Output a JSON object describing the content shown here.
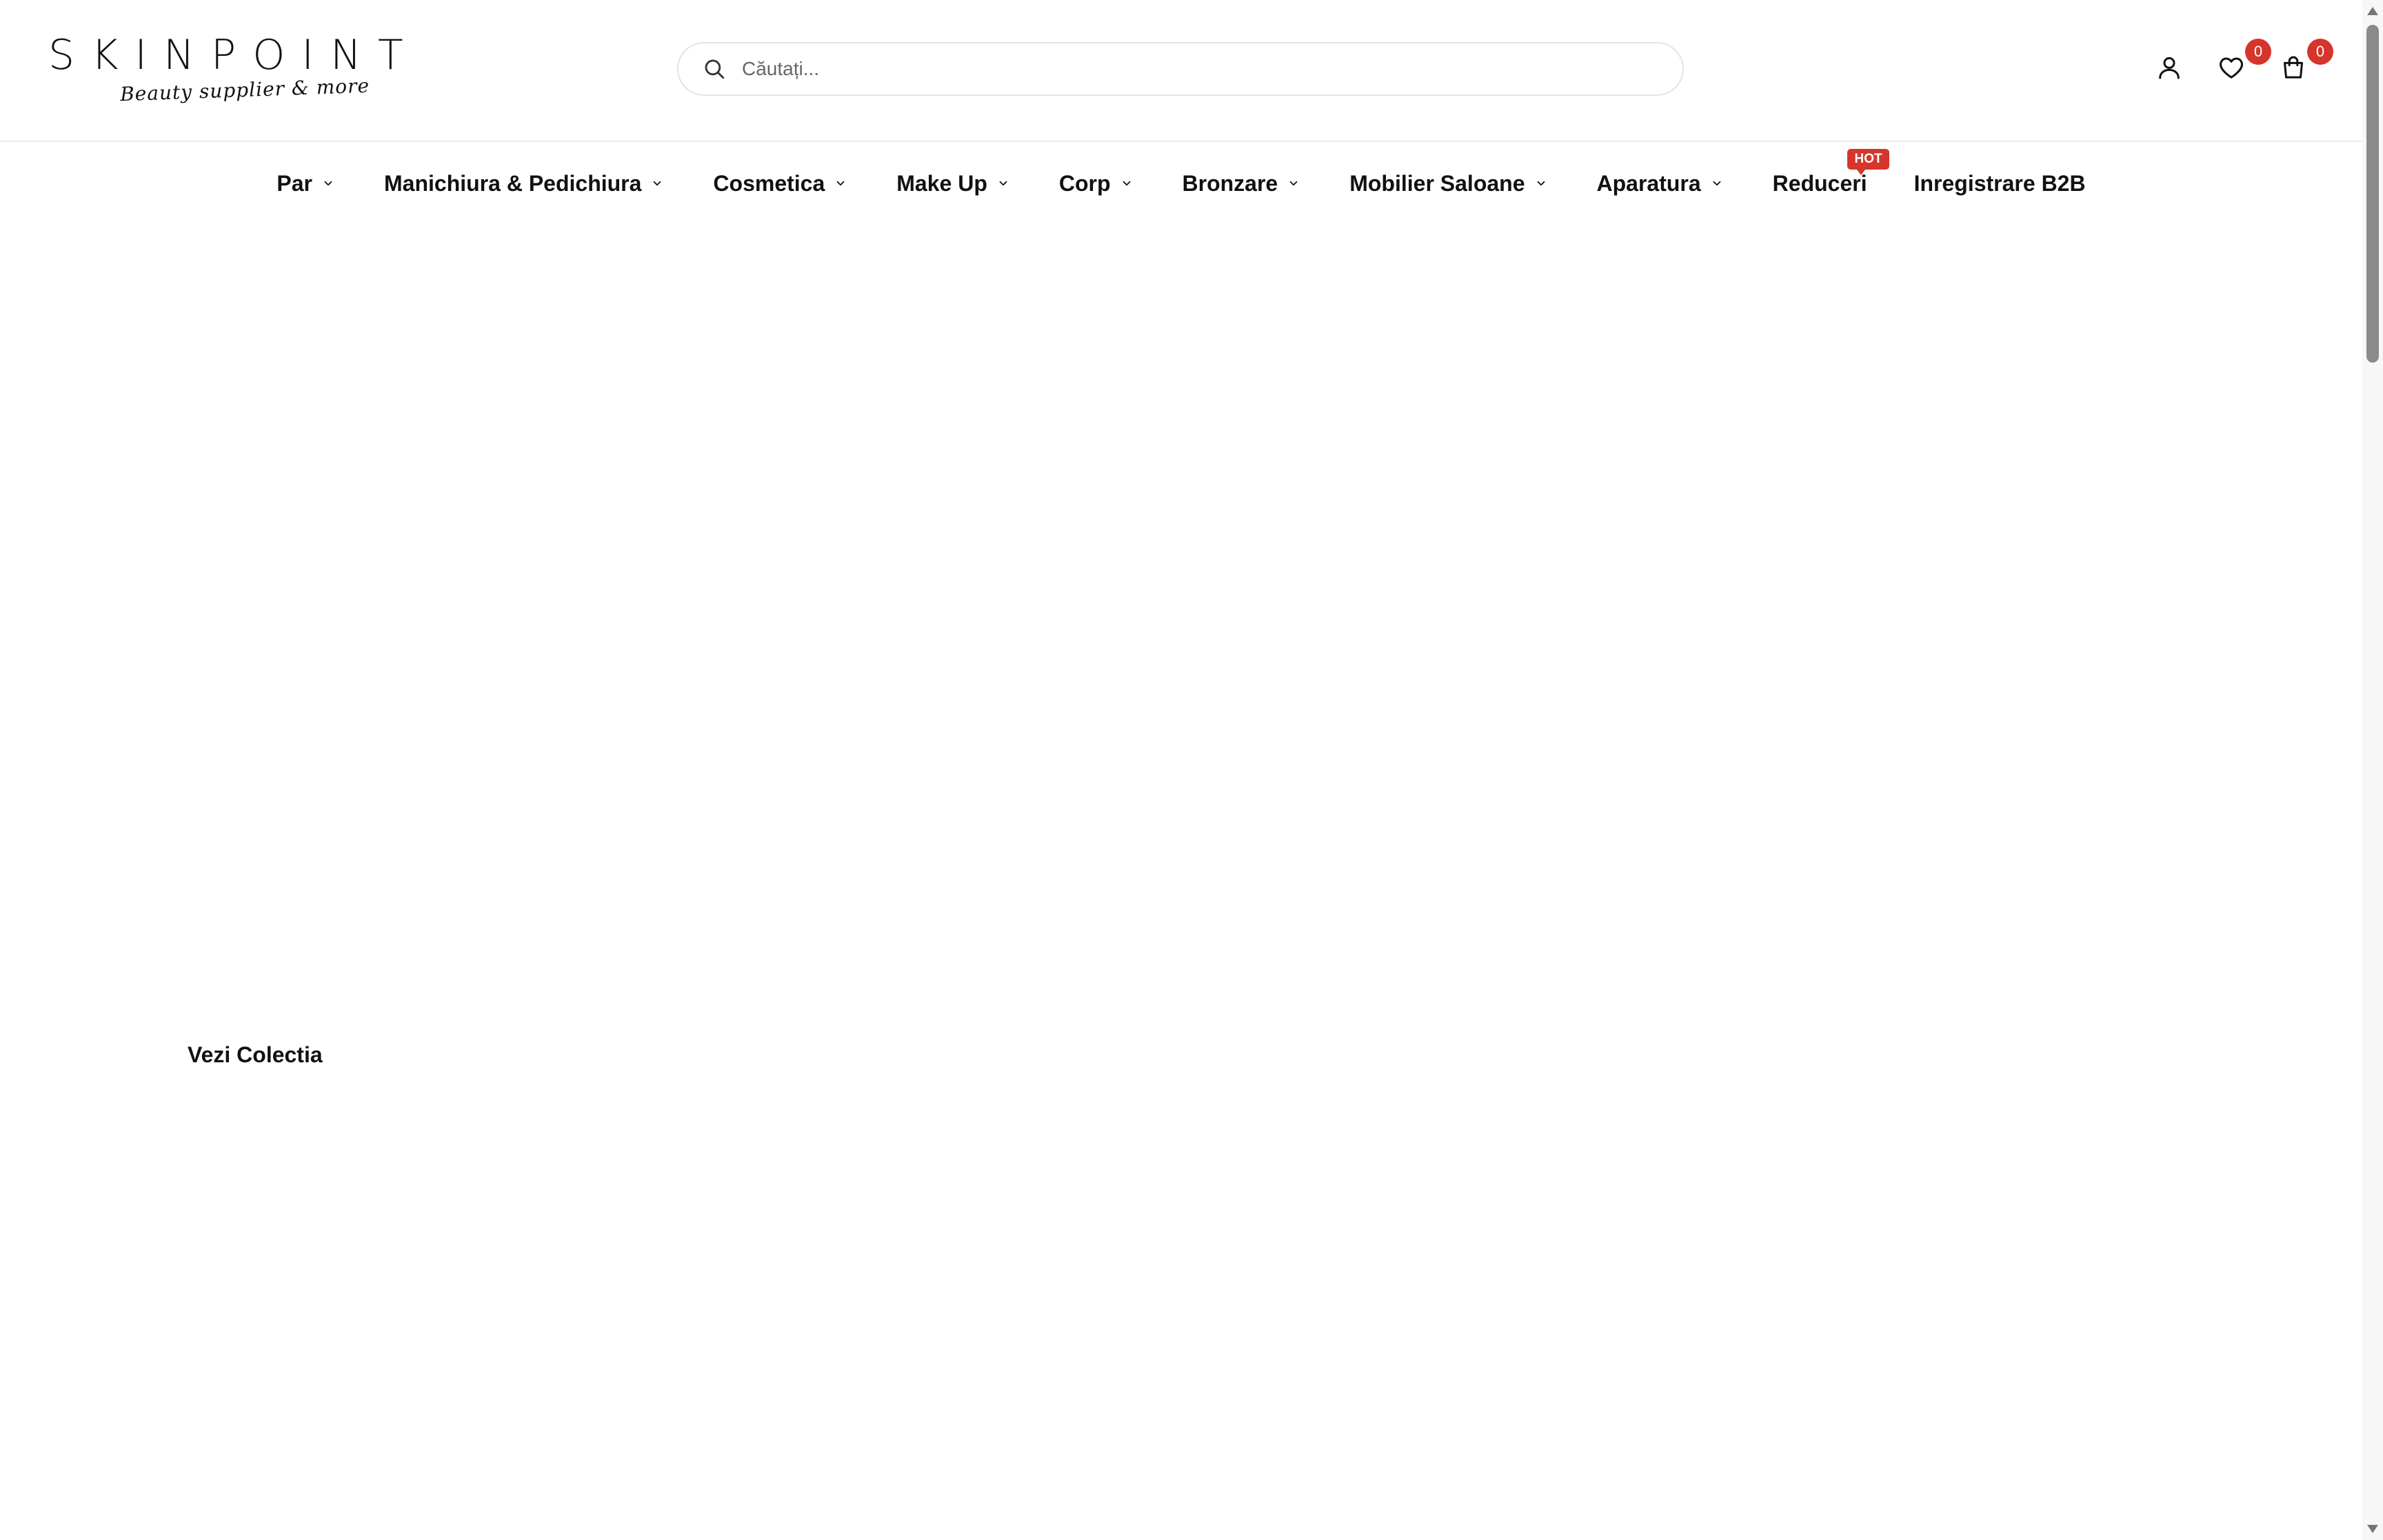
{
  "header": {
    "logo": {
      "wordmark": "SKINPOINT",
      "tagline": "Beauty supplier & more"
    },
    "search": {
      "placeholder": "Căutați...",
      "value": "",
      "icon": "search-icon"
    },
    "account": {
      "icon": "user-icon"
    },
    "wishlist": {
      "icon": "heart-icon",
      "count": "0"
    },
    "cart": {
      "icon": "shopping-bag-icon",
      "count": "0"
    }
  },
  "nav": {
    "items": [
      {
        "label": "Par",
        "has_dropdown": true
      },
      {
        "label": "Manichiura & Pedichiura",
        "has_dropdown": true
      },
      {
        "label": "Cosmetica",
        "has_dropdown": true
      },
      {
        "label": "Make Up",
        "has_dropdown": true
      },
      {
        "label": "Corp",
        "has_dropdown": true
      },
      {
        "label": "Bronzare",
        "has_dropdown": true
      },
      {
        "label": "Mobilier Saloane",
        "has_dropdown": true
      },
      {
        "label": "Aparatura",
        "has_dropdown": true
      },
      {
        "label": "Reduceri",
        "has_dropdown": false,
        "badge": "HOT"
      },
      {
        "label": "Inregistrare B2B",
        "has_dropdown": false
      }
    ]
  },
  "hero": {
    "link_label": "Vezi Colectia"
  },
  "colors": {
    "accent": "#d6352c",
    "text": "#111111",
    "border": "#e3e3e3"
  }
}
